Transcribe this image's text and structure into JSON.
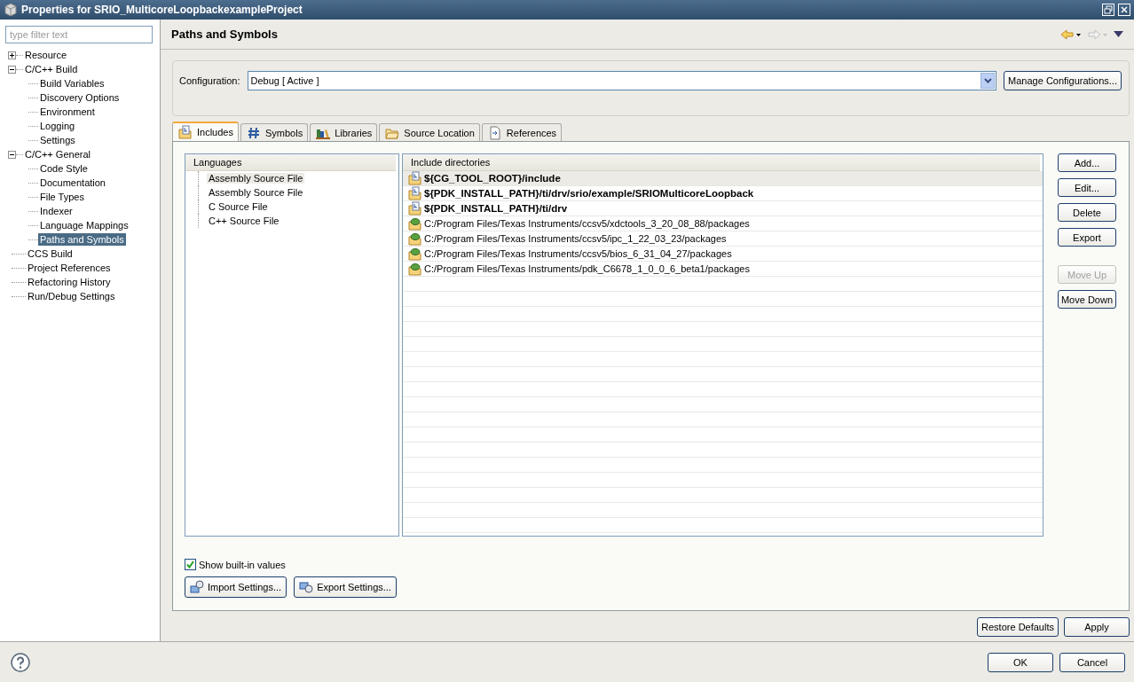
{
  "window": {
    "title": "Properties for SRIO_MulticoreLoopbackexampleProject"
  },
  "filter": {
    "placeholder": "type filter text"
  },
  "tree": [
    {
      "label": "Resource",
      "expanded": false,
      "selected": false
    },
    {
      "label": "C/C++ Build",
      "expanded": true,
      "selected": false,
      "children": [
        {
          "label": "Build Variables",
          "selected": false
        },
        {
          "label": "Discovery Options",
          "selected": false
        },
        {
          "label": "Environment",
          "selected": false
        },
        {
          "label": "Logging",
          "selected": false
        },
        {
          "label": "Settings",
          "selected": false
        }
      ]
    },
    {
      "label": "C/C++ General",
      "expanded": true,
      "selected": false,
      "children": [
        {
          "label": "Code Style",
          "selected": false
        },
        {
          "label": "Documentation",
          "selected": false
        },
        {
          "label": "File Types",
          "selected": false
        },
        {
          "label": "Indexer",
          "selected": false
        },
        {
          "label": "Language Mappings",
          "selected": false
        },
        {
          "label": "Paths and Symbols",
          "selected": true
        }
      ]
    },
    {
      "label": "CCS Build",
      "selected": false
    },
    {
      "label": "Project References",
      "selected": false
    },
    {
      "label": "Refactoring History",
      "selected": false
    },
    {
      "label": "Run/Debug Settings",
      "selected": false
    }
  ],
  "page_title": "Paths and Symbols",
  "configuration": {
    "label": "Configuration:",
    "value": "Debug  [ Active ]",
    "button": "Manage Configurations..."
  },
  "tabs": [
    {
      "label": "Includes",
      "kind": "includes",
      "selected": true
    },
    {
      "label": "Symbols",
      "kind": "symbols",
      "selected": false
    },
    {
      "label": "Libraries",
      "kind": "libraries",
      "selected": false
    },
    {
      "label": "Source Location",
      "kind": "source",
      "selected": false
    },
    {
      "label": "References",
      "kind": "references",
      "selected": false
    }
  ],
  "languages": {
    "header": "Languages",
    "items": [
      {
        "label": "Assembly Source File",
        "selected": true
      },
      {
        "label": "Assembly Source File",
        "selected": false
      },
      {
        "label": "C Source File",
        "selected": false
      },
      {
        "label": "C++ Source File",
        "selected": false
      }
    ]
  },
  "include_directories": {
    "header": "Include directories",
    "rows": [
      {
        "path": "${CG_TOOL_ROOT}/include",
        "kind": "user",
        "selected": true
      },
      {
        "path": "${PDK_INSTALL_PATH}/ti/drv/srio/example/SRIOMulticoreLoopback",
        "kind": "user",
        "selected": false
      },
      {
        "path": "${PDK_INSTALL_PATH}/ti/drv",
        "kind": "user",
        "selected": false
      },
      {
        "path": "C:/Program Files/Texas Instruments/ccsv5/xdctools_3_20_08_88/packages",
        "kind": "builtin",
        "selected": false
      },
      {
        "path": "C:/Program Files/Texas Instruments/ccsv5/ipc_1_22_03_23/packages",
        "kind": "builtin",
        "selected": false
      },
      {
        "path": "C:/Program Files/Texas Instruments/ccsv5/bios_6_31_04_27/packages",
        "kind": "builtin",
        "selected": false
      },
      {
        "path": "C:/Program Files/Texas Instruments/pdk_C6678_1_0_0_6_beta1/packages",
        "kind": "builtin",
        "selected": false
      }
    ]
  },
  "side_buttons": [
    {
      "label": "Add...",
      "disabled": false
    },
    {
      "label": "Edit...",
      "disabled": false
    },
    {
      "label": "Delete",
      "disabled": false
    },
    {
      "label": "Export",
      "disabled": false
    },
    {
      "label": "Move Up",
      "disabled": true
    },
    {
      "label": "Move Down",
      "disabled": false
    }
  ],
  "show_builtin": {
    "label": "Show built-in values",
    "checked": true
  },
  "settings_buttons": [
    {
      "label": "Import Settings...",
      "kind": "import"
    },
    {
      "label": "Export Settings...",
      "kind": "export"
    }
  ],
  "page_buttons": [
    "Restore Defaults",
    "Apply"
  ],
  "dialog_buttons": [
    "OK",
    "Cancel"
  ]
}
